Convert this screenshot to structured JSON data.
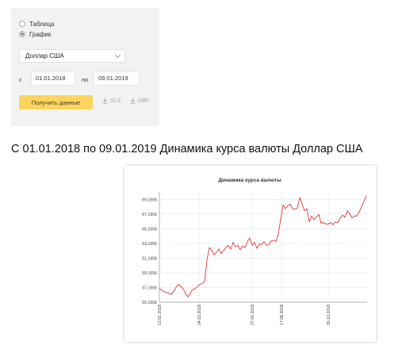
{
  "form": {
    "view_options": [
      {
        "label": "Таблица",
        "selected": false
      },
      {
        "label": "График",
        "selected": true
      }
    ],
    "currency": {
      "value": "Доллар США"
    },
    "date_from": {
      "label": "с",
      "value": "01.01.2018"
    },
    "date_to": {
      "label": "по",
      "value": "09.01.2019"
    },
    "submit_label": "Получить данные",
    "download_xls": "XLS",
    "download_dbf": "DBF"
  },
  "heading": "С 01.01.2018 по 09.01.2019 Динамика курса валюты Доллар США",
  "colors": {
    "accent_button": "#ffd45c",
    "series_line": "#e02020",
    "grid": "#d8d8d8"
  },
  "chart_data": {
    "type": "line",
    "title": "Динамика курса валюты",
    "ylim": [
      55.1656,
      70.1656
    ],
    "y_ticks": [
      "55,1656",
      "57,1656",
      "59,1656",
      "61,1656",
      "63,1656",
      "65,1656",
      "67,1656",
      "69,1656"
    ],
    "y_tick_values": [
      55.1656,
      57.1656,
      59.1656,
      61.1656,
      63.1656,
      65.1656,
      67.1656,
      69.1656
    ],
    "x_ticks": [
      "13.01.2018",
      "24.03.2018",
      "27.06.2018",
      "17.08.2018",
      "26.10.2018"
    ],
    "x_tick_positions": [
      0,
      50,
      117,
      154,
      213
    ],
    "x_range": [
      0,
      262
    ],
    "grid": true,
    "series": [
      {
        "x": [
          0,
          3,
          6,
          9,
          12,
          15,
          18,
          21,
          24,
          27,
          30,
          33,
          36,
          39,
          42,
          45,
          48,
          51,
          54,
          57,
          60,
          63,
          66,
          69,
          72,
          75,
          78,
          81,
          84,
          87,
          90,
          93,
          96,
          99,
          102,
          105,
          108,
          111,
          114,
          117,
          120,
          123,
          126,
          129,
          132,
          135,
          138,
          141,
          144,
          147,
          150,
          153,
          156,
          159,
          162,
          165,
          168,
          171,
          174,
          177,
          180,
          183,
          186,
          189,
          192,
          195,
          198,
          201,
          204,
          207,
          210,
          213,
          216,
          219,
          222,
          225,
          228,
          231,
          234,
          237,
          240,
          243,
          246,
          249,
          252,
          255,
          258,
          261
        ],
        "values": [
          57.0,
          56.8,
          56.6,
          56.5,
          56.4,
          56.2,
          56.6,
          57.2,
          57.6,
          57.3,
          57.0,
          56.3,
          55.9,
          56.4,
          56.9,
          57.0,
          57.3,
          57.6,
          57.7,
          58.0,
          60.9,
          62.6,
          62.2,
          61.6,
          62.0,
          62.4,
          61.8,
          62.2,
          62.6,
          62.9,
          62.4,
          63.3,
          62.7,
          62.9,
          62.3,
          62.8,
          62.6,
          63.4,
          63.9,
          62.9,
          63.3,
          62.5,
          63.1,
          63.0,
          63.4,
          62.9,
          63.0,
          63.5,
          63.6,
          63.4,
          64.4,
          66.5,
          68.4,
          67.9,
          68.3,
          68.5,
          67.9,
          67.8,
          68.0,
          69.4,
          68.5,
          67.6,
          67.9,
          66.1,
          66.9,
          66.4,
          66.7,
          67.1,
          65.9,
          66.0,
          65.8,
          65.8,
          66.0,
          65.7,
          66.1,
          66.0,
          66.6,
          67.0,
          66.7,
          67.6,
          67.2,
          66.6,
          66.9,
          66.9,
          67.4,
          68.2,
          68.9,
          69.6
        ]
      }
    ]
  }
}
